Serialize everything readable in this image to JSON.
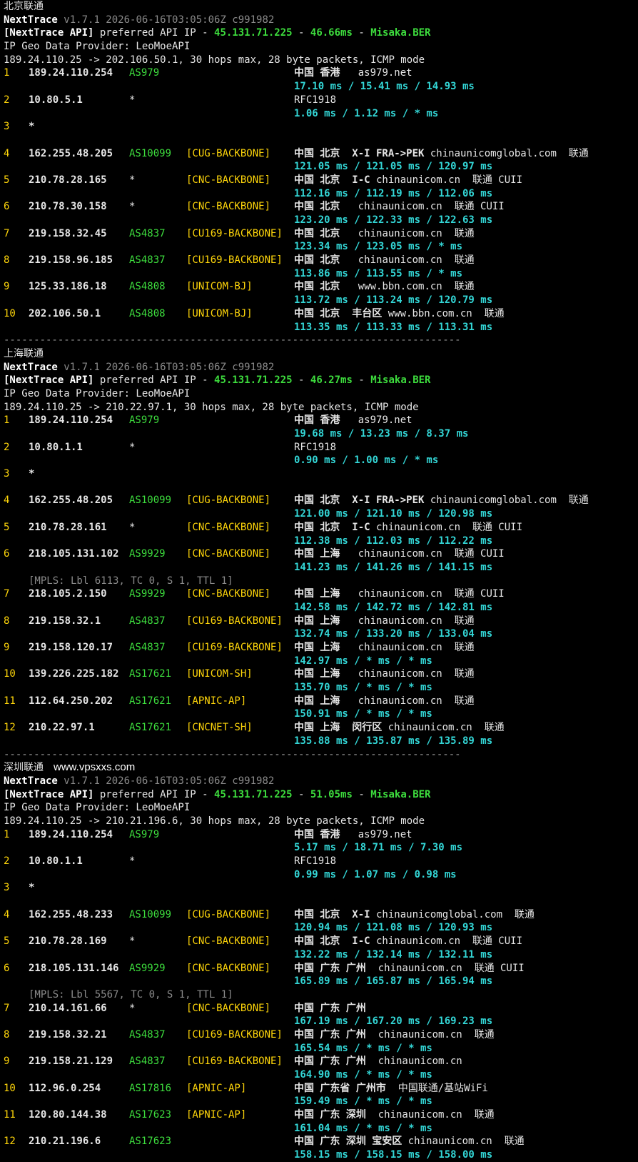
{
  "colors": {
    "hop_number": "#ffd60a",
    "asn": "#3ddc3d",
    "backbone_tag": "#ffd60a",
    "latency": "#33d6d6",
    "dim": "#8a8a8a"
  },
  "watermark": "www.vpsxxs.com",
  "separator": "----------------------------------------------------------------------------",
  "sections": [
    {
      "title": "北京联通",
      "header": {
        "tool": "NextTrace",
        "version": "v1.7.1 2026-06-16T03:05:06Z c991982",
        "api_tag": "[NextTrace API]",
        "api_text": " preferred API IP - ",
        "api_ip": "45.131.71.225",
        "api_dash": " - ",
        "api_ms": "46.66ms",
        "api_dash2": " - ",
        "api_node": "Misaka.BER",
        "geo": "IP Geo Data Provider: LeoMoeAPI",
        "route": "189.24.110.25 -> 202.106.50.1, 30 hops max, 28 byte packets, ICMP mode"
      },
      "hops": [
        {
          "n": "1",
          "ip": "189.24.110.254",
          "as": "AS979",
          "tag": "",
          "loc_bold": "中国 香港",
          "loc_rest": "   as979.net",
          "lat": "17.10 ms / 15.41 ms / 14.93 ms"
        },
        {
          "n": "2",
          "ip": "10.80.5.1",
          "as": "*",
          "tag": "",
          "loc_bold": "",
          "loc_rest": "RFC1918",
          "lat": "1.06 ms / 1.12 ms / * ms"
        },
        {
          "n": "3",
          "ip": "*",
          "as": "",
          "tag": "",
          "loc_bold": "",
          "loc_rest": "",
          "lat": ""
        },
        {
          "n": "4",
          "ip": "162.255.48.205",
          "as": "AS10099",
          "tag": "[CUG-BACKBONE]",
          "loc_bold": "中国 北京  X-I FRA->PEK",
          "loc_rest": " chinaunicomglobal.com  联通",
          "lat": "121.05 ms / 121.05 ms / 120.97 ms"
        },
        {
          "n": "5",
          "ip": "210.78.28.165",
          "as": "*",
          "tag": "[CNC-BACKBONE]",
          "loc_bold": "中国 北京  I-C",
          "loc_rest": " chinaunicom.cn  联通 CUII",
          "lat": "112.16 ms / 112.19 ms / 112.06 ms"
        },
        {
          "n": "6",
          "ip": "210.78.30.158",
          "as": "*",
          "tag": "[CNC-BACKBONE]",
          "loc_bold": "中国 北京",
          "loc_rest": "   chinaunicom.cn  联通 CUII",
          "lat": "123.20 ms / 122.33 ms / 122.63 ms"
        },
        {
          "n": "7",
          "ip": "219.158.32.45",
          "as": "AS4837",
          "tag": "[CU169-BACKBONE]",
          "loc_bold": "中国 北京",
          "loc_rest": "   chinaunicom.cn  联通",
          "lat": "123.34 ms / 123.05 ms / * ms"
        },
        {
          "n": "8",
          "ip": "219.158.96.185",
          "as": "AS4837",
          "tag": "[CU169-BACKBONE]",
          "loc_bold": "中国 北京",
          "loc_rest": "   chinaunicom.cn  联通",
          "lat": "113.86 ms / 113.55 ms / * ms"
        },
        {
          "n": "9",
          "ip": "125.33.186.18",
          "as": "AS4808",
          "tag": "[UNICOM-BJ]",
          "loc_bold": "中国 北京",
          "loc_rest": "   www.bbn.com.cn  联通",
          "lat": "113.72 ms / 113.24 ms / 120.79 ms"
        },
        {
          "n": "10",
          "ip": "202.106.50.1",
          "as": "AS4808",
          "tag": "[UNICOM-BJ]",
          "loc_bold": "中国 北京  丰台区",
          "loc_rest": " www.bbn.com.cn  联通",
          "lat": "113.35 ms / 113.33 ms / 113.31 ms"
        }
      ]
    },
    {
      "title": "上海联通",
      "header": {
        "tool": "NextTrace",
        "version": "v1.7.1 2026-06-16T03:05:06Z c991982",
        "api_tag": "[NextTrace API]",
        "api_text": " preferred API IP - ",
        "api_ip": "45.131.71.225",
        "api_dash": " - ",
        "api_ms": "46.27ms",
        "api_dash2": " - ",
        "api_node": "Misaka.BER",
        "geo": "IP Geo Data Provider: LeoMoeAPI",
        "route": "189.24.110.25 -> 210.22.97.1, 30 hops max, 28 byte packets, ICMP mode"
      },
      "hops": [
        {
          "n": "1",
          "ip": "189.24.110.254",
          "as": "AS979",
          "tag": "",
          "loc_bold": "中国 香港",
          "loc_rest": "   as979.net",
          "lat": "19.68 ms / 13.23 ms / 8.37 ms"
        },
        {
          "n": "2",
          "ip": "10.80.1.1",
          "as": "*",
          "tag": "",
          "loc_bold": "",
          "loc_rest": "RFC1918",
          "lat": "0.90 ms / 1.00 ms / * ms"
        },
        {
          "n": "3",
          "ip": "*",
          "as": "",
          "tag": "",
          "loc_bold": "",
          "loc_rest": "",
          "lat": ""
        },
        {
          "n": "4",
          "ip": "162.255.48.205",
          "as": "AS10099",
          "tag": "[CUG-BACKBONE]",
          "loc_bold": "中国 北京  X-I FRA->PEK",
          "loc_rest": " chinaunicomglobal.com  联通",
          "lat": "121.00 ms / 121.10 ms / 120.98 ms"
        },
        {
          "n": "5",
          "ip": "210.78.28.161",
          "as": "*",
          "tag": "[CNC-BACKBONE]",
          "loc_bold": "中国 北京  I-C",
          "loc_rest": " chinaunicom.cn  联通 CUII",
          "lat": "112.38 ms / 112.03 ms / 112.22 ms"
        },
        {
          "n": "6",
          "ip": "218.105.131.102",
          "as": "AS9929",
          "tag": "[CNC-BACKBONE]",
          "loc_bold": "中国 上海",
          "loc_rest": "   chinaunicom.cn  联通 CUII",
          "lat": "141.23 ms / 141.26 ms / 141.15 ms",
          "mpls": "[MPLS: Lbl 6113, TC 0, S 1, TTL 1]"
        },
        {
          "n": "7",
          "ip": "218.105.2.150",
          "as": "AS9929",
          "tag": "[CNC-BACKBONE]",
          "loc_bold": "中国 上海",
          "loc_rest": "   chinaunicom.cn  联通 CUII",
          "lat": "142.58 ms / 142.72 ms / 142.81 ms"
        },
        {
          "n": "8",
          "ip": "219.158.32.1",
          "as": "AS4837",
          "tag": "[CU169-BACKBONE]",
          "loc_bold": "中国 上海",
          "loc_rest": "   chinaunicom.cn  联通",
          "lat": "132.74 ms / 133.20 ms / 133.04 ms"
        },
        {
          "n": "9",
          "ip": "219.158.120.17",
          "as": "AS4837",
          "tag": "[CU169-BACKBONE]",
          "loc_bold": "中国 上海",
          "loc_rest": "   chinaunicom.cn  联通",
          "lat": "142.97 ms / * ms / * ms"
        },
        {
          "n": "10",
          "ip": "139.226.225.182",
          "as": "AS17621",
          "tag": "[UNICOM-SH]",
          "loc_bold": "中国 上海",
          "loc_rest": "   chinaunicom.cn  联通",
          "lat": "135.70 ms / * ms / * ms"
        },
        {
          "n": "11",
          "ip": "112.64.250.202",
          "as": "AS17621",
          "tag": "[APNIC-AP]",
          "loc_bold": "中国 上海",
          "loc_rest": "   chinaunicom.cn  联通",
          "lat": "150.91 ms / * ms / * ms"
        },
        {
          "n": "12",
          "ip": "210.22.97.1",
          "as": "AS17621",
          "tag": "[CNCNET-SH]",
          "loc_bold": "中国 上海  闵行区",
          "loc_rest": " chinaunicom.cn  联通",
          "lat": "135.88 ms / 135.87 ms / 135.89 ms"
        }
      ]
    },
    {
      "title": "深圳联通",
      "header": {
        "tool": "NextTrace",
        "version": "v1.7.1 2026-06-16T03:05:06Z c991982",
        "api_tag": "[NextTrace API]",
        "api_text": " preferred API IP - ",
        "api_ip": "45.131.71.225",
        "api_dash": " - ",
        "api_ms": "51.05ms",
        "api_dash2": " - ",
        "api_node": "Misaka.BER",
        "geo": "IP Geo Data Provider: LeoMoeAPI",
        "route": "189.24.110.25 -> 210.21.196.6, 30 hops max, 28 byte packets, ICMP mode"
      },
      "hops": [
        {
          "n": "1",
          "ip": "189.24.110.254",
          "as": "AS979",
          "tag": "",
          "loc_bold": "中国 香港",
          "loc_rest": "   as979.net",
          "lat": "5.17 ms / 18.71 ms / 7.30 ms"
        },
        {
          "n": "2",
          "ip": "10.80.1.1",
          "as": "*",
          "tag": "",
          "loc_bold": "",
          "loc_rest": "RFC1918",
          "lat": "0.99 ms / 1.07 ms / 0.98 ms"
        },
        {
          "n": "3",
          "ip": "*",
          "as": "",
          "tag": "",
          "loc_bold": "",
          "loc_rest": "",
          "lat": ""
        },
        {
          "n": "4",
          "ip": "162.255.48.233",
          "as": "AS10099",
          "tag": "[CUG-BACKBONE]",
          "loc_bold": "中国 北京  X-I",
          "loc_rest": " chinaunicomglobal.com  联通",
          "lat": "120.94 ms / 121.08 ms / 120.93 ms"
        },
        {
          "n": "5",
          "ip": "210.78.28.169",
          "as": "*",
          "tag": "[CNC-BACKBONE]",
          "loc_bold": "中国 北京  I-C",
          "loc_rest": " chinaunicom.cn  联通 CUII",
          "lat": "132.22 ms / 132.14 ms / 132.11 ms"
        },
        {
          "n": "6",
          "ip": "218.105.131.146",
          "as": "AS9929",
          "tag": "[CNC-BACKBONE]",
          "loc_bold": "中国 广东 广州",
          "loc_rest": "  chinaunicom.cn  联通 CUII",
          "lat": "165.89 ms / 165.87 ms / 165.94 ms",
          "mpls": "[MPLS: Lbl 5567, TC 0, S 1, TTL 1]"
        },
        {
          "n": "7",
          "ip": "210.14.161.66",
          "as": "*",
          "tag": "[CNC-BACKBONE]",
          "loc_bold": "中国 广东 广州",
          "loc_rest": "",
          "lat": "167.19 ms / 167.20 ms / 169.23 ms"
        },
        {
          "n": "8",
          "ip": "219.158.32.21",
          "as": "AS4837",
          "tag": "[CU169-BACKBONE]",
          "loc_bold": "中国 广东 广州",
          "loc_rest": "  chinaunicom.cn  联通",
          "lat": "165.54 ms / * ms / * ms"
        },
        {
          "n": "9",
          "ip": "219.158.21.129",
          "as": "AS4837",
          "tag": "[CU169-BACKBONE]",
          "loc_bold": "中国 广东 广州",
          "loc_rest": "  chinaunicom.cn",
          "lat": "164.90 ms / * ms / * ms"
        },
        {
          "n": "10",
          "ip": "112.96.0.254",
          "as": "AS17816",
          "tag": "[APNIC-AP]",
          "loc_bold": "中国 广东省 广州市",
          "loc_rest": "  中国联通/基站WiFi",
          "lat": "159.49 ms / * ms / * ms"
        },
        {
          "n": "11",
          "ip": "120.80.144.38",
          "as": "AS17623",
          "tag": "[APNIC-AP]",
          "loc_bold": "中国 广东 深圳",
          "loc_rest": "  chinaunicom.cn  联通",
          "lat": "161.04 ms / * ms / * ms"
        },
        {
          "n": "12",
          "ip": "210.21.196.6",
          "as": "AS17623",
          "tag": "",
          "loc_bold": "中国 广东 深圳 宝安区",
          "loc_rest": " chinaunicom.cn  联通",
          "lat": "158.15 ms / 158.15 ms / 158.00 ms"
        }
      ]
    }
  ]
}
